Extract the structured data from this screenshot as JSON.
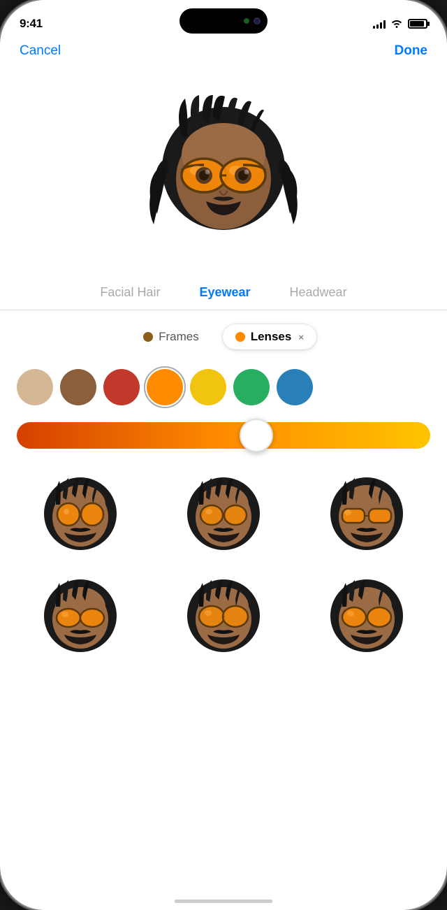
{
  "statusBar": {
    "time": "9:41",
    "signalBars": [
      4,
      6,
      8,
      10,
      12
    ],
    "batteryLevel": 90
  },
  "nav": {
    "cancelLabel": "Cancel",
    "doneLabel": "Done"
  },
  "categoryTabs": {
    "tabs": [
      {
        "id": "facial-hair",
        "label": "Facial Hair",
        "active": false
      },
      {
        "id": "eyewear",
        "label": "Eyewear",
        "active": true
      },
      {
        "id": "headwear",
        "label": "Headwear",
        "active": false
      }
    ]
  },
  "filterPills": {
    "frames": {
      "label": "Frames",
      "color": "#8B5E1A",
      "active": false
    },
    "lenses": {
      "label": "Lenses",
      "color": "#FF8C00",
      "active": true,
      "closeLabel": "×"
    }
  },
  "colorSwatches": [
    {
      "id": "beige",
      "color": "#D4B896",
      "selected": false
    },
    {
      "id": "brown",
      "color": "#8B5E3C",
      "selected": false
    },
    {
      "id": "red",
      "color": "#C0392B",
      "selected": false
    },
    {
      "id": "orange",
      "color": "#FF8C00",
      "selected": true
    },
    {
      "id": "yellow",
      "color": "#F1C40F",
      "selected": false
    },
    {
      "id": "green",
      "color": "#27AE60",
      "selected": false
    },
    {
      "id": "blue",
      "color": "#2980B9",
      "selected": false
    }
  ],
  "slider": {
    "gradientStart": "#d44000",
    "gradientMid": "#ff8c00",
    "gradientEnd": "#ffc400",
    "value": 58
  },
  "memojiGrid": {
    "items": [
      {
        "id": 1
      },
      {
        "id": 2
      },
      {
        "id": 3
      },
      {
        "id": 4
      },
      {
        "id": 5
      },
      {
        "id": 6
      }
    ]
  }
}
